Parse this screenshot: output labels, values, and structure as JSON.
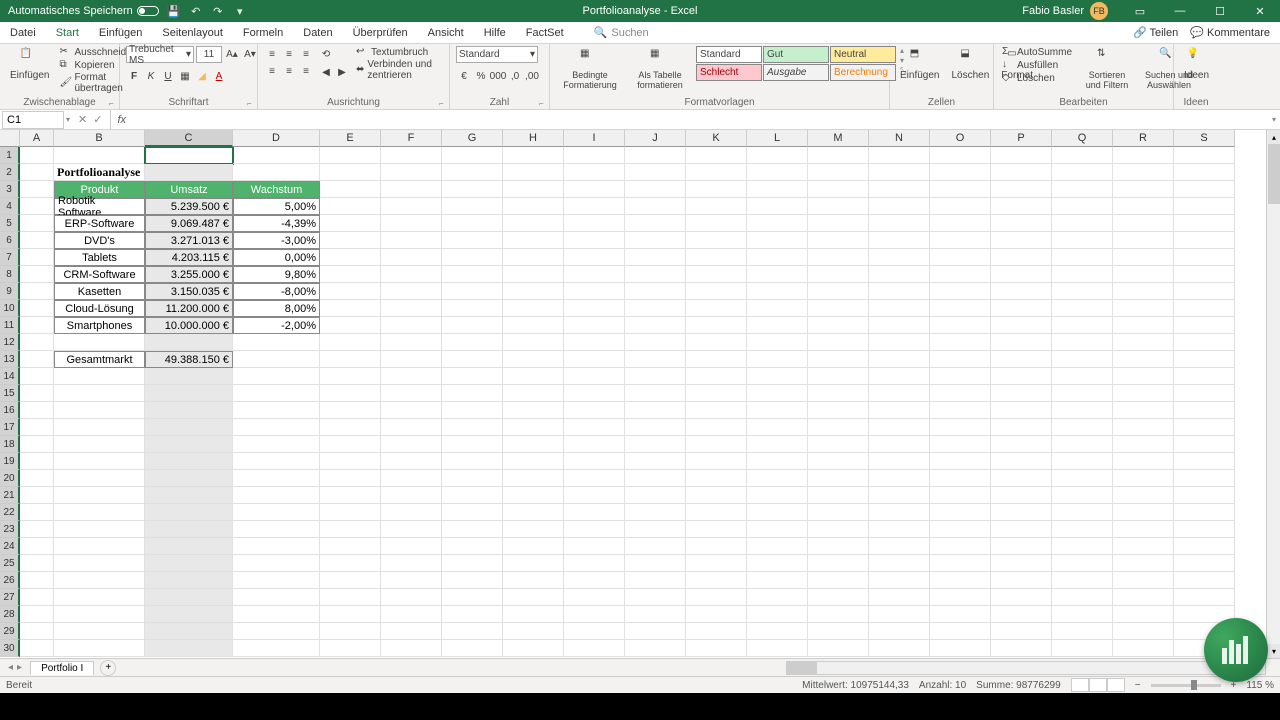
{
  "title": "Portfolioanalyse - Excel",
  "user": {
    "name": "Fabio Basler",
    "initials": "FB"
  },
  "autosave_label": "Automatisches Speichern",
  "menu": [
    "Datei",
    "Start",
    "Einfügen",
    "Seitenlayout",
    "Formeln",
    "Daten",
    "Überprüfen",
    "Ansicht",
    "Hilfe",
    "FactSet"
  ],
  "menu_active": "Start",
  "search_placeholder": "Suchen",
  "share_label": "Teilen",
  "comments_label": "Kommentare",
  "ribbon": {
    "clipboard": {
      "label": "Zwischenablage",
      "paste": "Einfügen",
      "cut": "Ausschneiden",
      "copy": "Kopieren",
      "format": "Format übertragen"
    },
    "font": {
      "label": "Schriftart",
      "name": "Trebuchet MS",
      "size": "11"
    },
    "align": {
      "label": "Ausrichtung",
      "wrap": "Textumbruch",
      "merge": "Verbinden und zentrieren"
    },
    "number": {
      "label": "Zahl",
      "format": "Standard"
    },
    "styles": {
      "label": "Formatvorlagen",
      "cond": "Bedingte Formatierung",
      "table": "Als Tabelle formatieren",
      "s1": "Standard",
      "s2": "Gut",
      "s3": "Neutral",
      "s4": "Schlecht",
      "s5": "Ausgabe",
      "s6": "Berechnung"
    },
    "cells": {
      "label": "Zellen",
      "insert": "Einfügen",
      "delete": "Löschen",
      "format": "Format"
    },
    "editing": {
      "label": "Bearbeiten",
      "sum": "AutoSumme",
      "fill": "Ausfüllen",
      "clear": "Löschen",
      "sort": "Sortieren und Filtern",
      "find": "Suchen und Auswählen"
    },
    "ideas": {
      "label": "Ideen",
      "btn": "Ideen"
    }
  },
  "namebox": "C1",
  "columns": [
    "A",
    "B",
    "C",
    "D",
    "E",
    "F",
    "G",
    "H",
    "I",
    "J",
    "K",
    "L",
    "M",
    "N",
    "O",
    "P",
    "Q",
    "R",
    "S"
  ],
  "col_widths": {
    "A": 34,
    "B": 91,
    "C": 88,
    "D": 87,
    "default": 61
  },
  "selected_col": "C",
  "table": {
    "title": "Portfolioanalyse",
    "headers": [
      "Produkt",
      "Umsatz",
      "Wachstum"
    ],
    "rows": [
      {
        "p": "Robotik Software",
        "u": "5.239.500 €",
        "w": "5,00%"
      },
      {
        "p": "ERP-Software",
        "u": "9.069.487 €",
        "w": "-4,39%"
      },
      {
        "p": "DVD's",
        "u": "3.271.013 €",
        "w": "-3,00%"
      },
      {
        "p": "Tablets",
        "u": "4.203.115 €",
        "w": "0,00%"
      },
      {
        "p": "CRM-Software",
        "u": "3.255.000 €",
        "w": "9,80%"
      },
      {
        "p": "Kasetten",
        "u": "3.150.035 €",
        "w": "-8,00%"
      },
      {
        "p": "Cloud-Lösung",
        "u": "11.200.000 €",
        "w": "8,00%"
      },
      {
        "p": "Smartphones",
        "u": "10.000.000 €",
        "w": "-2,00%"
      }
    ],
    "total_label": "Gesamtmarkt",
    "total_value": "49.388.150 €"
  },
  "sheet_tab": "Portfolio I",
  "status": {
    "ready": "Bereit",
    "avg": "Mittelwert: 10975144,33",
    "count": "Anzahl: 10",
    "sum": "Summe: 98776299",
    "zoom": "115 %"
  }
}
